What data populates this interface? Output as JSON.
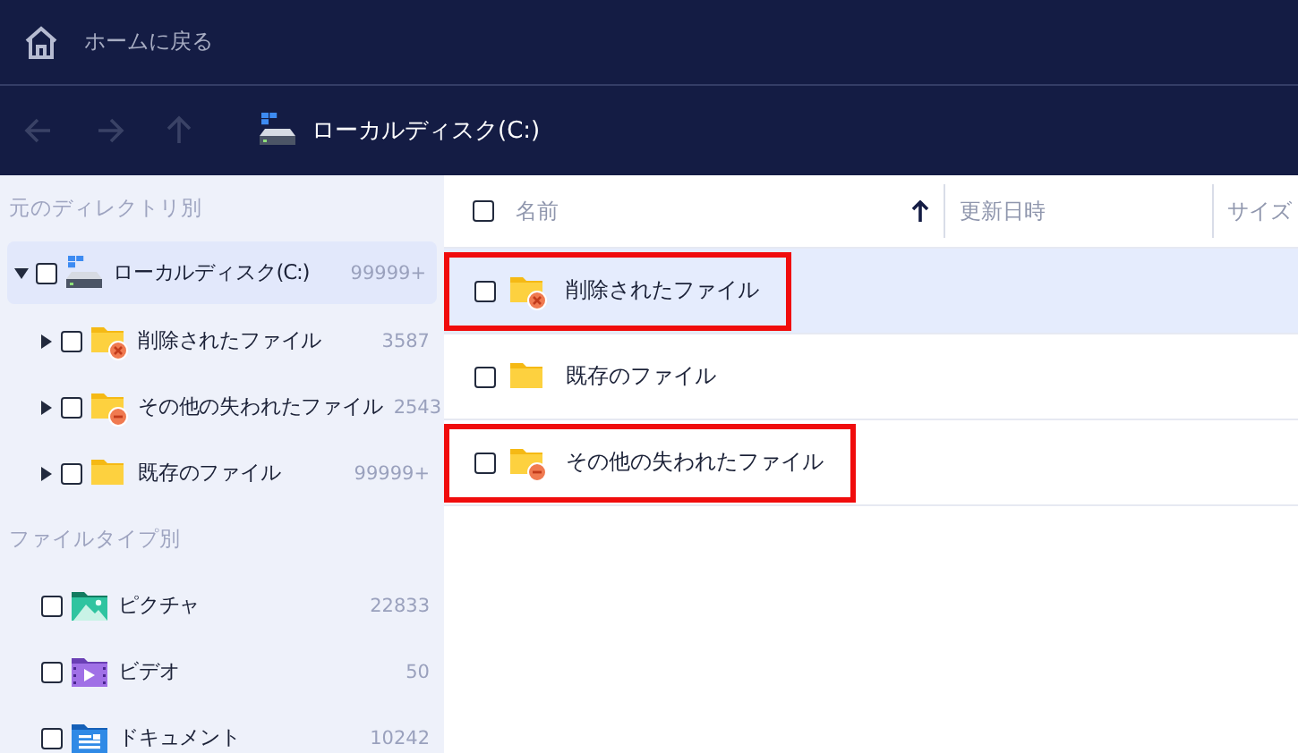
{
  "topbar": {
    "home_label": "ホームに戻る"
  },
  "nav": {
    "buttons": [
      {
        "kind": "back",
        "disabled": true
      },
      {
        "kind": "forward",
        "disabled": true
      },
      {
        "kind": "up",
        "disabled": true
      }
    ],
    "location": "ローカルディスク(C:)"
  },
  "sidebar": {
    "directory_heading": "元のディレクトリ別",
    "tree": [
      {
        "kind": "drive",
        "label": "ローカルディスク(C:)",
        "count": "99999+",
        "expanded": true,
        "checked": false,
        "selected": true,
        "children": [
          {
            "kind": "deleted",
            "label": "削除されたファイル",
            "count": "3587",
            "expanded": false,
            "checked": false,
            "selected": false
          },
          {
            "kind": "lost",
            "label": "その他の失われたファイル",
            "count": "2543",
            "expanded": false,
            "checked": false,
            "selected": false
          },
          {
            "kind": "existing",
            "label": "既存のファイル",
            "count": "99999+",
            "expanded": false,
            "checked": false,
            "selected": false
          }
        ]
      }
    ],
    "type_heading": "ファイルタイプ別",
    "types": [
      {
        "kind": "picture",
        "label": "ピクチャ",
        "count": "22833",
        "checked": false
      },
      {
        "kind": "video",
        "label": "ビデオ",
        "count": "50",
        "checked": false
      },
      {
        "kind": "document",
        "label": "ドキュメント",
        "count": "10242",
        "checked": false
      }
    ]
  },
  "table": {
    "select_all_checked": false,
    "columns": [
      {
        "label": "名前",
        "sorted": true
      },
      {
        "label": "更新日時",
        "sorted": false
      },
      {
        "label": "サイズ",
        "sorted": false
      }
    ],
    "rows": [
      {
        "kind": "deleted",
        "name": "削除されたファイル",
        "checked": false,
        "selected": true,
        "highlighted": true
      },
      {
        "kind": "existing",
        "name": "既存のファイル",
        "checked": false,
        "selected": false,
        "highlighted": false
      },
      {
        "kind": "lost",
        "name": "その他の失われたファイル",
        "checked": false,
        "selected": false,
        "highlighted": true
      }
    ]
  }
}
